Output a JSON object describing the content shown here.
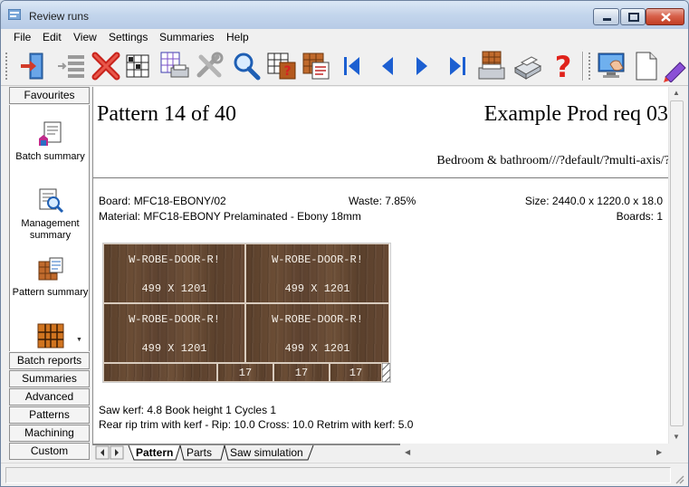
{
  "window": {
    "title": "Review runs"
  },
  "menu": [
    "File",
    "Edit",
    "View",
    "Settings",
    "Summaries",
    "Help"
  ],
  "toolbar_icons": [
    "exit-icon",
    "insert-rows-icon",
    "delete-icon",
    "board-list-icon",
    "print-preview-icon",
    "tools-off-icon",
    "search-icon",
    "help-book-icon",
    "report-icon",
    "first-icon",
    "previous-icon",
    "next-icon",
    "last-icon",
    "print-pattern-icon",
    "printer-icon",
    "help-icon",
    "monitor-hand-icon",
    "new-document-icon",
    "pencil-icon"
  ],
  "sidebar": {
    "favourites": "Favourites",
    "items": [
      {
        "label": "Batch summary",
        "icon": "batch-summary-icon"
      },
      {
        "label": "Management summary",
        "icon": "management-summary-icon"
      },
      {
        "label": "Pattern summary",
        "icon": "pattern-summary-icon"
      },
      {
        "label": "",
        "icon": "pattern-grid-icon"
      }
    ],
    "sections": [
      "Batch reports",
      "Summaries",
      "Advanced",
      "Patterns",
      "Machining",
      "Custom"
    ]
  },
  "report": {
    "pattern_title": "Pattern 14 of 40",
    "run_name": "Example Prod req 03",
    "path": "Bedroom & bathroom///?default/?multi-axis/??",
    "board": "Board: MFC18-EBONY/02",
    "waste": "Waste: 7.85%",
    "size": "Size: 2440.0 x 1220.0 x  18.0",
    "material": "Material: MFC18-EBONY  Prelaminated - Ebony 18mm",
    "boards": "Boards: 1",
    "part_name": "W-ROBE-DOOR-R!",
    "part_size": "499 X 1201",
    "strip_counts": [
      "17",
      "17",
      "17"
    ],
    "saw_info": "Saw kerf: 4.8  Book height 1  Cycles 1",
    "trim_info": "Rear rip trim with kerf - Rip: 10.0 Cross: 10.0 Retrim with kerf: 5.0"
  },
  "tabs": [
    "Pattern",
    "Parts",
    "Saw simulation"
  ],
  "colors": {
    "wood": "#5e432f",
    "title_gradient": "#c3d5ec",
    "close": "#c13d23"
  }
}
